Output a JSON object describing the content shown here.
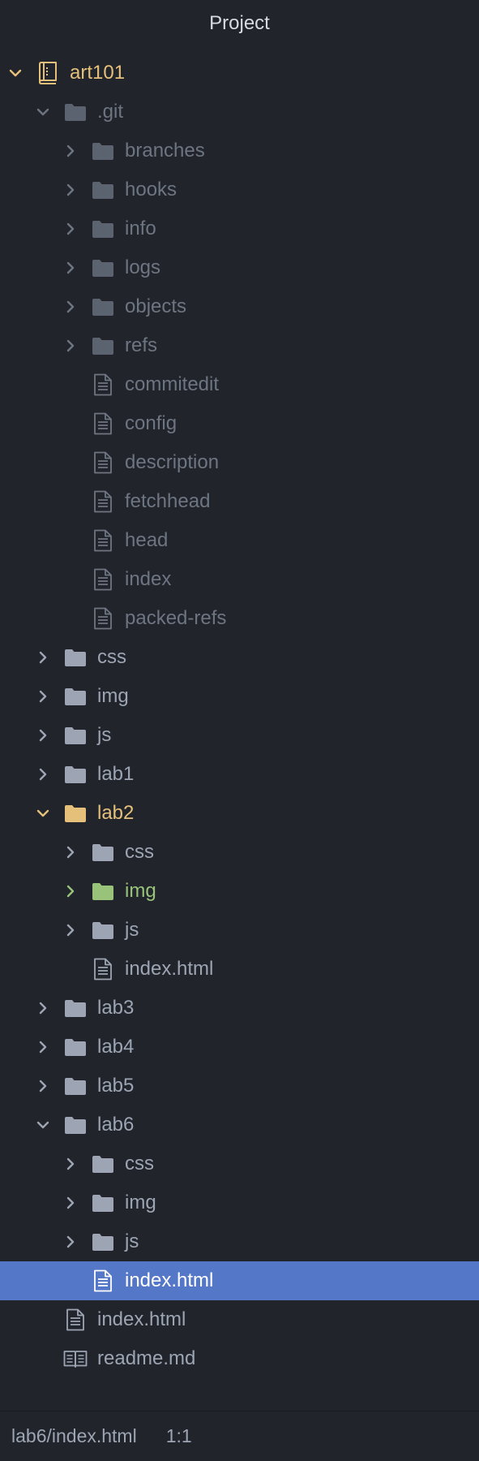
{
  "header": {
    "title": "Project"
  },
  "tree": [
    {
      "label": "art101",
      "level": 0,
      "kind": "repo",
      "expanded": true,
      "status": "modified",
      "icon": "book-icon"
    },
    {
      "label": ".git",
      "level": 1,
      "kind": "folder",
      "expanded": true,
      "status": "ignored",
      "icon": "folder-icon"
    },
    {
      "label": "branches",
      "level": 2,
      "kind": "folder",
      "expanded": false,
      "status": "ignored",
      "icon": "folder-icon"
    },
    {
      "label": "hooks",
      "level": 2,
      "kind": "folder",
      "expanded": false,
      "status": "ignored",
      "icon": "folder-icon"
    },
    {
      "label": "info",
      "level": 2,
      "kind": "folder",
      "expanded": false,
      "status": "ignored",
      "icon": "folder-icon"
    },
    {
      "label": "logs",
      "level": 2,
      "kind": "folder",
      "expanded": false,
      "status": "ignored",
      "icon": "folder-icon"
    },
    {
      "label": "objects",
      "level": 2,
      "kind": "folder",
      "expanded": false,
      "status": "ignored",
      "icon": "folder-icon"
    },
    {
      "label": "refs",
      "level": 2,
      "kind": "folder",
      "expanded": false,
      "status": "ignored",
      "icon": "folder-icon"
    },
    {
      "label": "commitedit",
      "level": 2,
      "kind": "file",
      "status": "ignored",
      "icon": "file-text-icon"
    },
    {
      "label": "config",
      "level": 2,
      "kind": "file",
      "status": "ignored",
      "icon": "file-text-icon"
    },
    {
      "label": "description",
      "level": 2,
      "kind": "file",
      "status": "ignored",
      "icon": "file-text-icon"
    },
    {
      "label": "fetchhead",
      "level": 2,
      "kind": "file",
      "status": "ignored",
      "icon": "file-text-icon"
    },
    {
      "label": "head",
      "level": 2,
      "kind": "file",
      "status": "ignored",
      "icon": "file-text-icon"
    },
    {
      "label": "index",
      "level": 2,
      "kind": "file",
      "status": "ignored",
      "icon": "file-text-icon"
    },
    {
      "label": "packed-refs",
      "level": 2,
      "kind": "file",
      "status": "ignored",
      "icon": "file-text-icon"
    },
    {
      "label": "css",
      "level": 1,
      "kind": "folder",
      "expanded": false,
      "status": "normal",
      "icon": "folder-icon"
    },
    {
      "label": "img",
      "level": 1,
      "kind": "folder",
      "expanded": false,
      "status": "normal",
      "icon": "folder-icon"
    },
    {
      "label": "js",
      "level": 1,
      "kind": "folder",
      "expanded": false,
      "status": "normal",
      "icon": "folder-icon"
    },
    {
      "label": "lab1",
      "level": 1,
      "kind": "folder",
      "expanded": false,
      "status": "normal",
      "icon": "folder-icon"
    },
    {
      "label": "lab2",
      "level": 1,
      "kind": "folder",
      "expanded": true,
      "status": "modified",
      "icon": "folder-icon"
    },
    {
      "label": "css",
      "level": 2,
      "kind": "folder",
      "expanded": false,
      "status": "normal",
      "icon": "folder-icon"
    },
    {
      "label": "img",
      "level": 2,
      "kind": "folder",
      "expanded": false,
      "status": "added",
      "icon": "folder-icon"
    },
    {
      "label": "js",
      "level": 2,
      "kind": "folder",
      "expanded": false,
      "status": "normal",
      "icon": "folder-icon"
    },
    {
      "label": "index.html",
      "level": 2,
      "kind": "file",
      "status": "normal",
      "icon": "file-text-icon"
    },
    {
      "label": "lab3",
      "level": 1,
      "kind": "folder",
      "expanded": false,
      "status": "normal",
      "icon": "folder-icon"
    },
    {
      "label": "lab4",
      "level": 1,
      "kind": "folder",
      "expanded": false,
      "status": "normal",
      "icon": "folder-icon"
    },
    {
      "label": "lab5",
      "level": 1,
      "kind": "folder",
      "expanded": false,
      "status": "normal",
      "icon": "folder-icon"
    },
    {
      "label": "lab6",
      "level": 1,
      "kind": "folder",
      "expanded": true,
      "status": "normal",
      "icon": "folder-icon"
    },
    {
      "label": "css",
      "level": 2,
      "kind": "folder",
      "expanded": false,
      "status": "normal",
      "icon": "folder-icon"
    },
    {
      "label": "img",
      "level": 2,
      "kind": "folder",
      "expanded": false,
      "status": "normal",
      "icon": "folder-icon"
    },
    {
      "label": "js",
      "level": 2,
      "kind": "folder",
      "expanded": false,
      "status": "normal",
      "icon": "folder-icon"
    },
    {
      "label": "index.html",
      "level": 2,
      "kind": "file",
      "status": "normal",
      "icon": "file-text-icon",
      "selected": true
    },
    {
      "label": "index.html",
      "level": 1,
      "kind": "file",
      "status": "normal",
      "icon": "file-text-icon"
    },
    {
      "label": "readme.md",
      "level": 1,
      "kind": "file",
      "status": "normal",
      "icon": "book-open-icon"
    }
  ],
  "statusbar": {
    "path": "lab6/index.html",
    "cursor": "1:1"
  },
  "colors": {
    "background": "#21252b",
    "text": "#9da5b4",
    "ignored": "#6e7582",
    "modified": "#e5c07b",
    "added": "#98c379",
    "selection": "#5577c7"
  }
}
